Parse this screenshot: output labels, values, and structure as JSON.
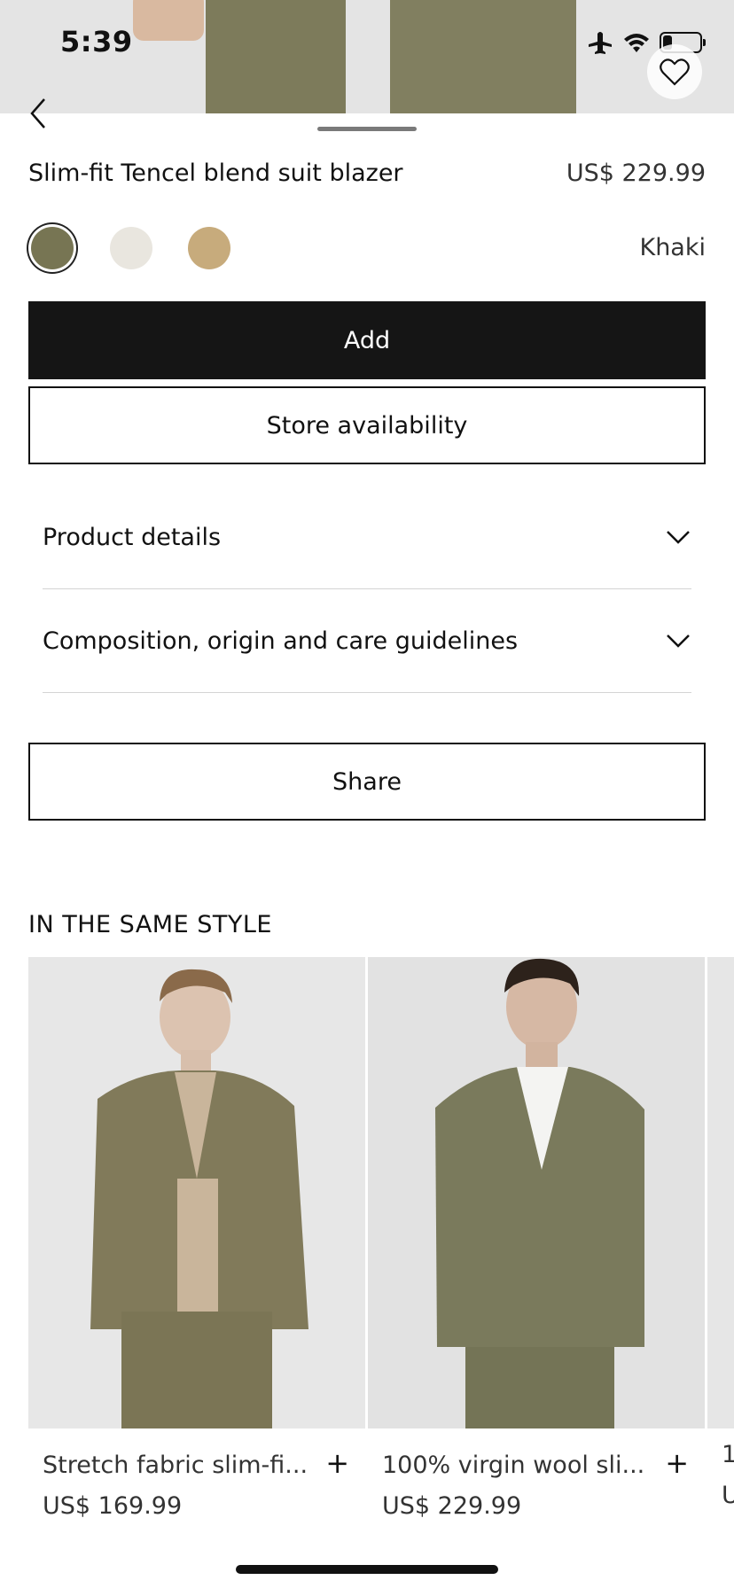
{
  "status": {
    "time": "5:39"
  },
  "product": {
    "title": "Slim-fit Tencel blend suit blazer",
    "price": "US$ 229.99",
    "selected_color": "Khaki",
    "swatches": [
      {
        "color": "#777553"
      },
      {
        "color": "#e9e6df"
      },
      {
        "color": "#c7ab7c"
      }
    ]
  },
  "actions": {
    "add_label": "Add",
    "store_label": "Store availability",
    "share_label": "Share"
  },
  "accordion": [
    {
      "label": "Product details"
    },
    {
      "label": "Composition, origin and care guidelines"
    }
  ],
  "related": {
    "heading": "IN THE SAME STYLE",
    "items": [
      {
        "name": "Stretch fabric slim-fi...",
        "price": "US$ 169.99"
      },
      {
        "name": "100% virgin wool sli...",
        "price": "US$ 229.99"
      },
      {
        "name": "1",
        "price": "U"
      }
    ]
  },
  "colors": {
    "suit": "#7d7b5b",
    "button_bg": "#151515"
  }
}
